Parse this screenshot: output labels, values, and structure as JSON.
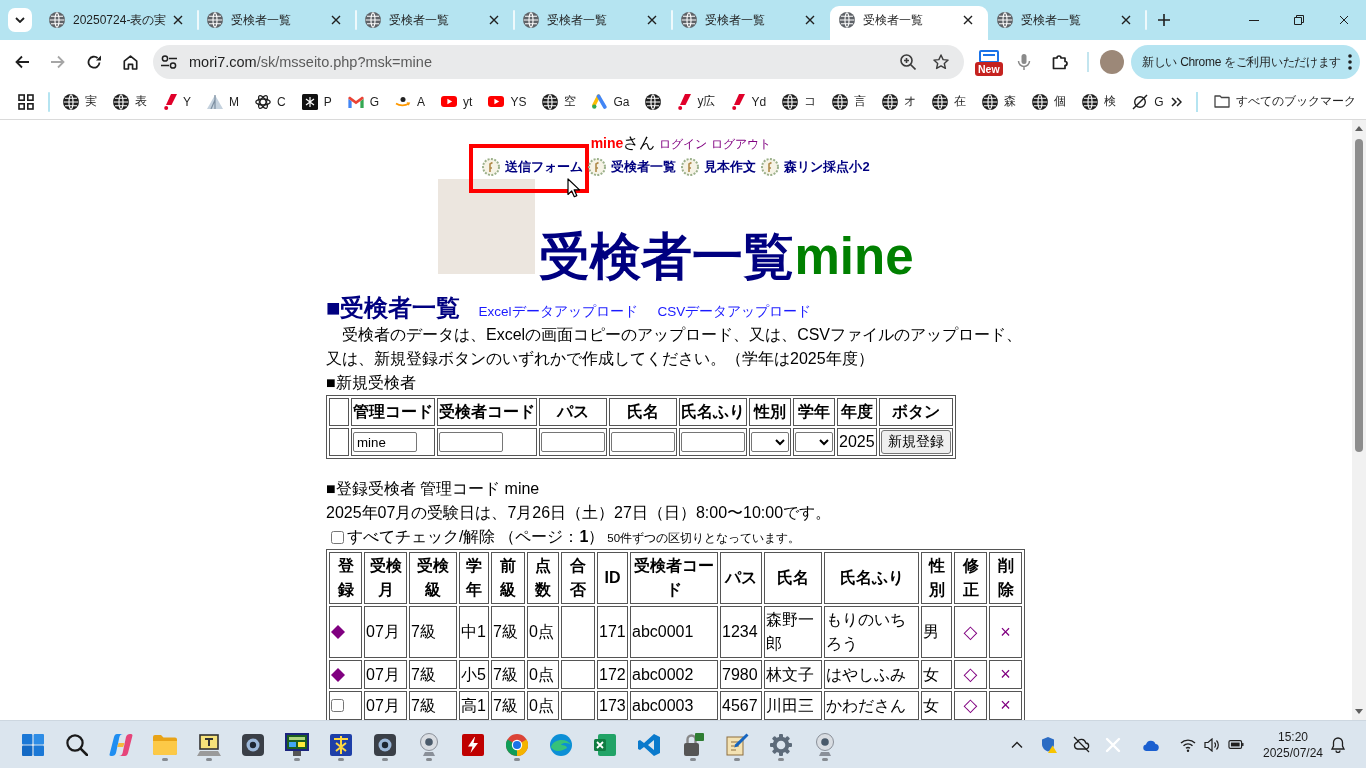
{
  "browser": {
    "tabs": [
      {
        "title": "20250724-表の実",
        "selected": false
      },
      {
        "title": "受検者一覧",
        "selected": false
      },
      {
        "title": "受検者一覧",
        "selected": false
      },
      {
        "title": "受検者一覧",
        "selected": false
      },
      {
        "title": "受検者一覧",
        "selected": false
      },
      {
        "title": "受検者一覧",
        "selected": true
      },
      {
        "title": "受検者一覧",
        "selected": false
      }
    ],
    "address_bar": {
      "host": "mori7.com",
      "path": "/sk/msseito.php?msk=mine"
    },
    "extension_badge": "New",
    "update_button": "新しい Chrome をご利用いただけます",
    "bookmarks": [
      {
        "kind": "globe",
        "label": "実"
      },
      {
        "kind": "globe",
        "label": "表"
      },
      {
        "kind": "yahoo",
        "label": "Y"
      },
      {
        "kind": "sail",
        "label": "M"
      },
      {
        "kind": "knot",
        "label": "C"
      },
      {
        "kind": "tile",
        "label": "P"
      },
      {
        "kind": "mail",
        "label": "G"
      },
      {
        "kind": "amazon",
        "label": "A"
      },
      {
        "kind": "youtube",
        "label": "yt"
      },
      {
        "kind": "youtube",
        "label": "YS"
      },
      {
        "kind": "globe",
        "label": "空"
      },
      {
        "kind": "ads",
        "label": "Ga"
      },
      {
        "kind": "globe"
      },
      {
        "kind": "yahoo",
        "label": "y広"
      },
      {
        "kind": "yahoo",
        "label": "Yd"
      },
      {
        "kind": "globe",
        "label": "コ"
      },
      {
        "kind": "globe",
        "label": "言"
      },
      {
        "kind": "globe",
        "label": "オ"
      },
      {
        "kind": "globe",
        "label": "在"
      },
      {
        "kind": "globe",
        "label": "森"
      },
      {
        "kind": "globe",
        "label": "個"
      },
      {
        "kind": "globe",
        "label": "検"
      },
      {
        "kind": "slashed",
        "label": "G"
      }
    ],
    "all_bookmarks": "すべてのブックマーク"
  },
  "page": {
    "user": {
      "name": "mine",
      "suffix": "さん"
    },
    "account_links": [
      "ログイン",
      "ログアウト"
    ],
    "nav": [
      {
        "label": "送信フォーム",
        "highlighted": true
      },
      {
        "label": "受検者一覧",
        "highlighted": false
      },
      {
        "label": "見本作文",
        "highlighted": false
      },
      {
        "label": "森リン採点小2",
        "highlighted": false
      }
    ],
    "title": {
      "text": "受検者一覧",
      "user": "mine"
    },
    "section": {
      "heading": "■受検者一覧",
      "links": [
        "Excelデータアップロード",
        "CSVデータアップロード"
      ],
      "intro": "　受検者のデータは、Excelの画面コピーのアップロード、又は、CSVファイルのアップロード、又は、新規登録ボタンのいずれかで作成してください。（学年は2025年度）"
    },
    "new_entry": {
      "heading": "■新規受検者",
      "columns": [
        "管理コード",
        "受検者コード",
        "パス",
        "氏名",
        "氏名ふり",
        "性別",
        "学年",
        "年度",
        "ボタン"
      ],
      "fields": [
        {
          "kind": "text",
          "value": "mine"
        },
        {
          "kind": "text"
        },
        {
          "kind": "text"
        },
        {
          "kind": "text"
        },
        {
          "kind": "text"
        },
        {
          "kind": "select"
        },
        {
          "kind": "select"
        },
        {
          "kind": "static",
          "text": "2025"
        },
        {
          "kind": "button",
          "label": "新規登録"
        }
      ]
    },
    "roster": {
      "heading": "■登録受検者 管理コード mine",
      "exam_note": "2025年07月の受験日は、7月26日（土）27日（日）8:00〜10:00です。",
      "check_all": {
        "label": "すべてチェック/解除",
        "checked": false
      },
      "page_info": "（ページ：**1**）",
      "page_note": "50件ずつの区切りとなっています。",
      "columns": [
        "登録",
        "受検月",
        "受検級",
        "学年",
        "前級",
        "点数",
        "合否",
        "ID",
        "受検者コード",
        "パス",
        "氏名",
        "氏名ふり",
        "性別",
        "修正",
        "削除"
      ],
      "rows": [
        {
          "registered": true,
          "month": "07月",
          "level": "7級",
          "school_year": "中1",
          "previous_level": "7級",
          "score": "0点",
          "id": "171",
          "code": "abc0001",
          "password": "1234",
          "name": "森野一郎",
          "kana": "もりのいちろう",
          "gender": "男",
          "edit": "◇",
          "delete": "×"
        },
        {
          "registered": true,
          "month": "07月",
          "level": "7級",
          "school_year": "小5",
          "previous_level": "7級",
          "score": "0点",
          "id": "172",
          "code": "abc0002",
          "password": "7980",
          "name": "林文子",
          "kana": "はやしふみ",
          "gender": "女",
          "edit": "◇",
          "delete": "×"
        },
        {
          "registered": false,
          "checked": false,
          "month": "07月",
          "level": "7級",
          "school_year": "高1",
          "previous_level": "7級",
          "score": "0点",
          "id": "173",
          "code": "abc0003",
          "password": "4567",
          "name": "川田三",
          "kana": "かわださん",
          "gender": "女",
          "edit": "◇",
          "delete": "×"
        }
      ]
    }
  },
  "taskbar": {
    "apps": [
      {
        "kind": "start",
        "running": false
      },
      {
        "kind": "search",
        "running": false
      },
      {
        "kind": "copilot",
        "running": false
      },
      {
        "kind": "folder",
        "running": true
      },
      {
        "kind": "laptop",
        "running": true
      },
      {
        "kind": "camera",
        "running": false
      },
      {
        "kind": "monitor",
        "running": true
      },
      {
        "kind": "tile",
        "running": true
      },
      {
        "kind": "camera",
        "running": true
      },
      {
        "kind": "webcam",
        "running": true
      },
      {
        "kind": "bolt",
        "running": false
      },
      {
        "kind": "chrome",
        "running": true
      },
      {
        "kind": "edge",
        "running": false
      },
      {
        "kind": "excel",
        "running": false
      },
      {
        "kind": "vscode",
        "running": false
      },
      {
        "kind": "padlock",
        "running": true
      },
      {
        "kind": "pencil",
        "running": true
      },
      {
        "kind": "gear",
        "running": true
      },
      {
        "kind": "webcam",
        "running": true
      }
    ],
    "clock": {
      "time": "15:20",
      "date": "2025/07/24"
    }
  }
}
